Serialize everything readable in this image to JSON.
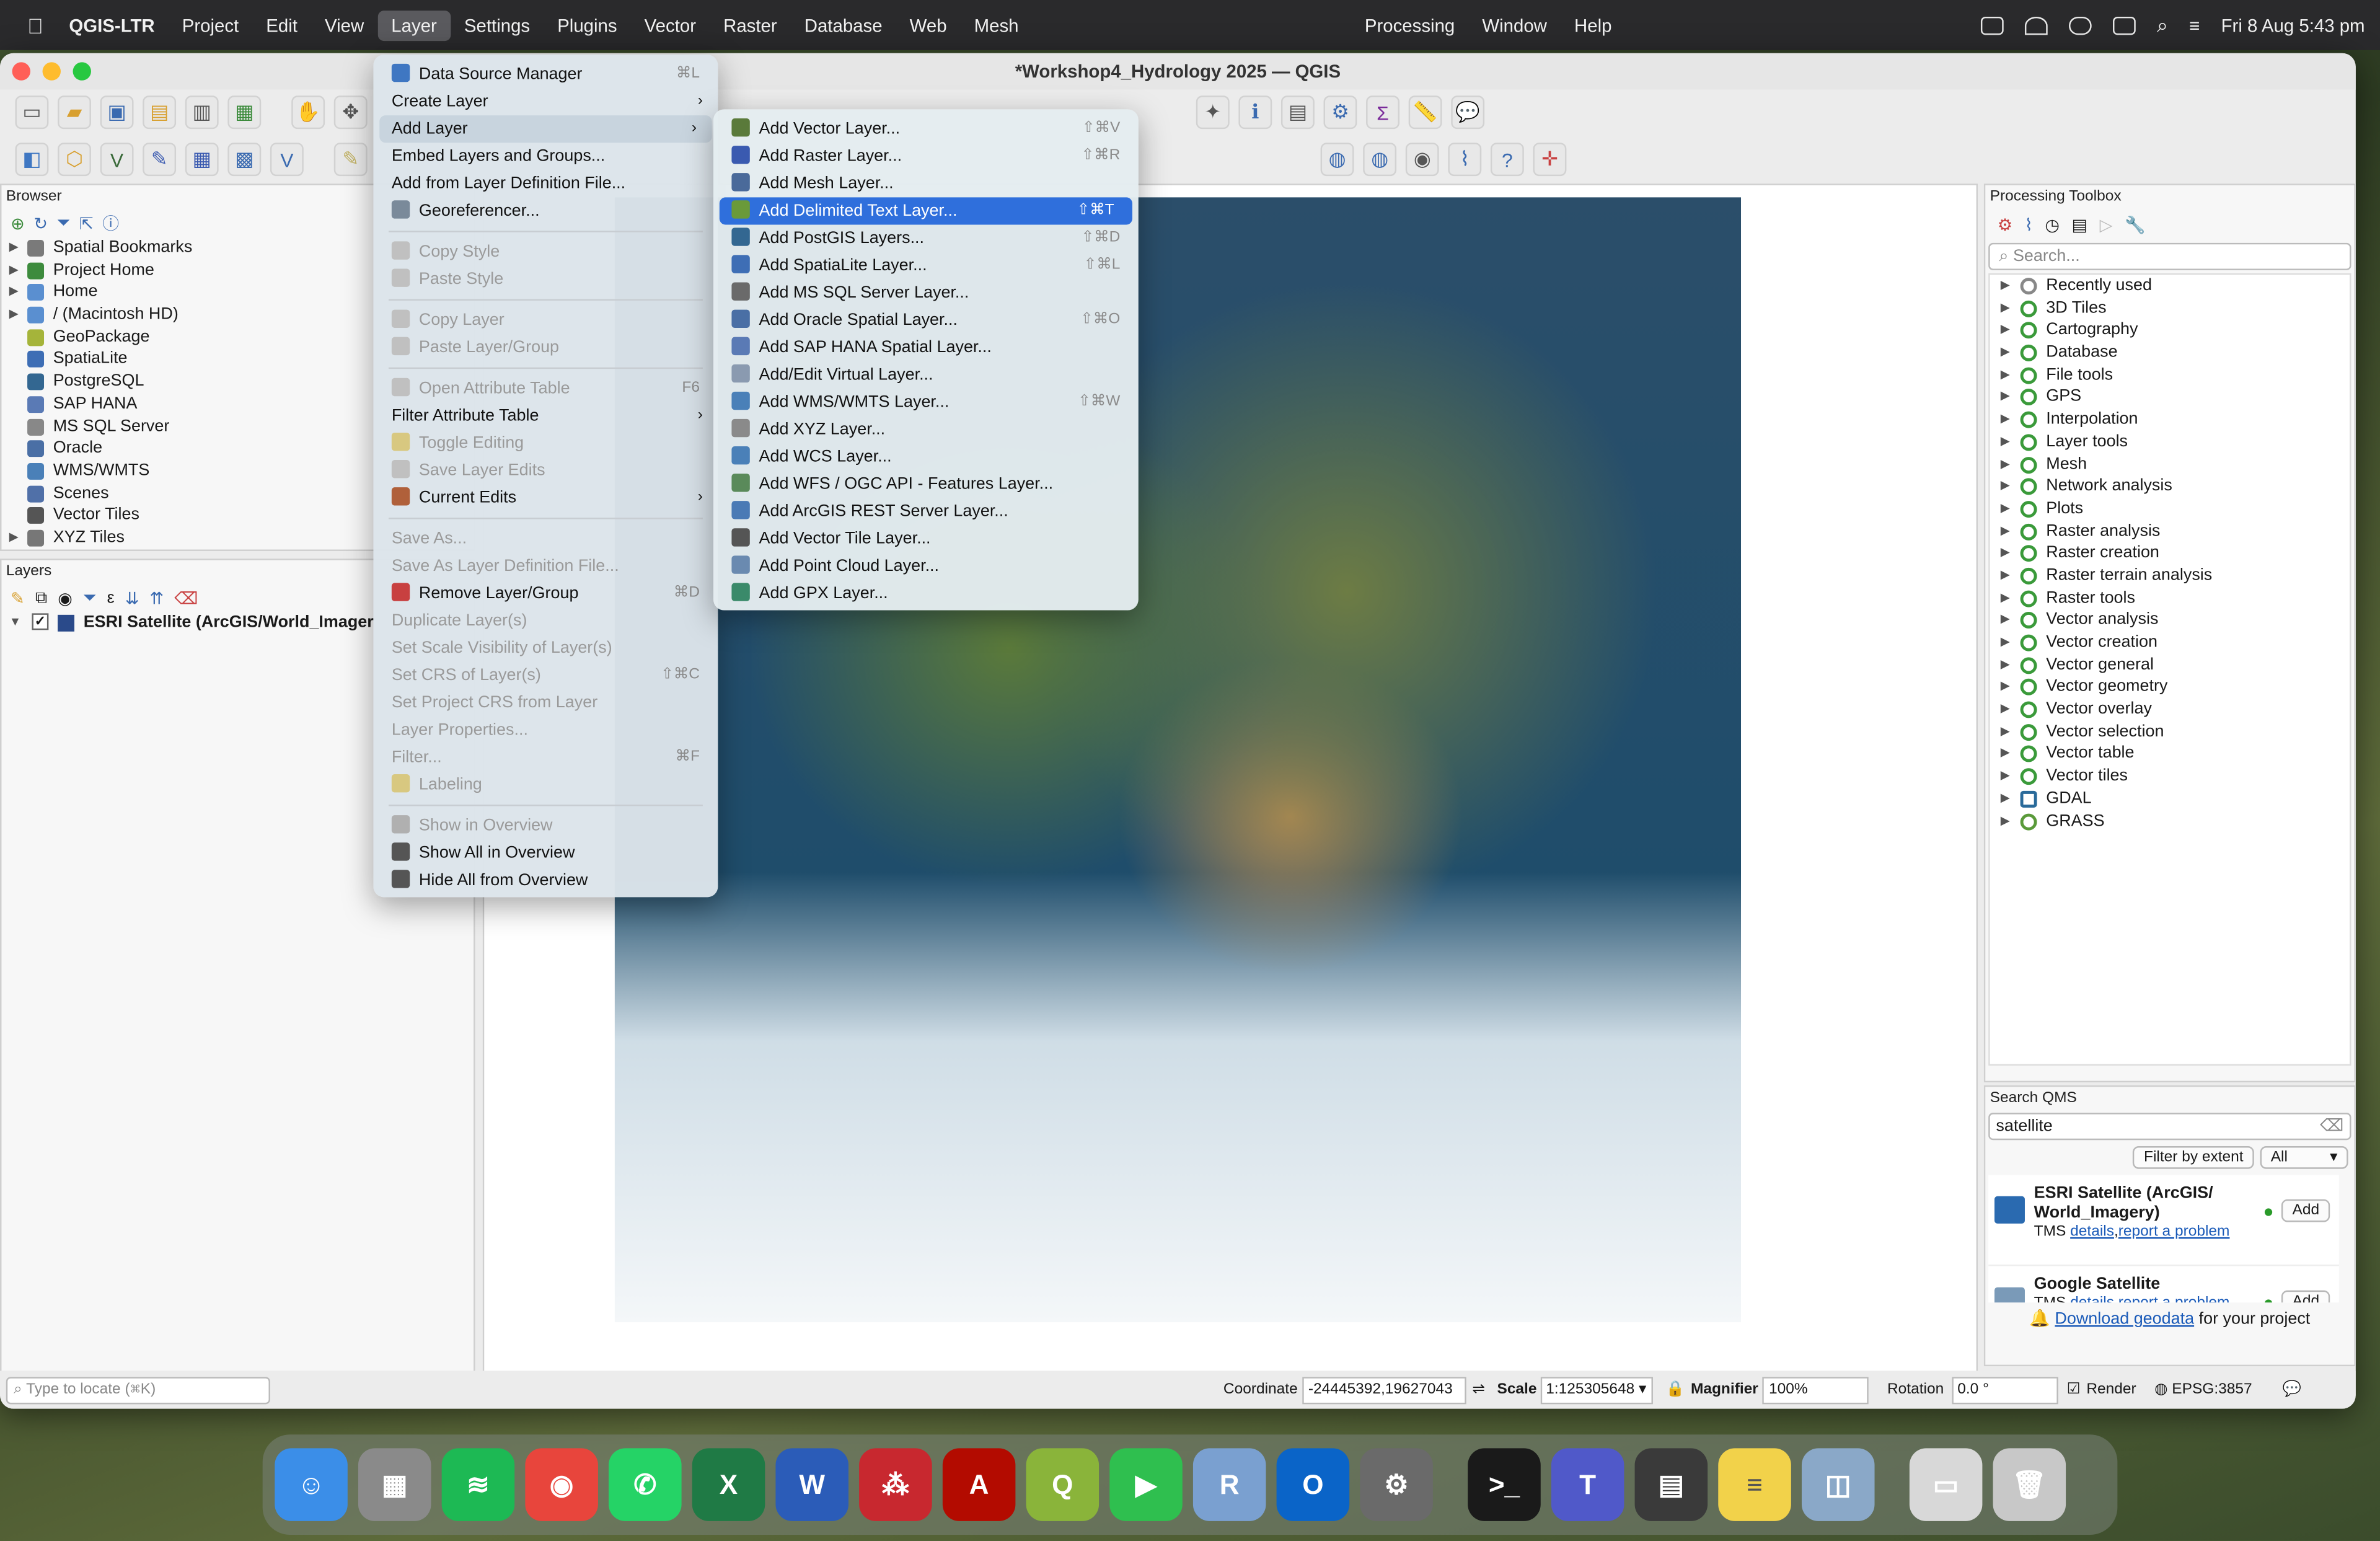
{
  "menubar": {
    "app": "QGIS-LTR",
    "items": [
      "Project",
      "Edit",
      "View",
      "Layer",
      "Settings",
      "Plugins",
      "Vector",
      "Raster",
      "Database",
      "Web",
      "Mesh"
    ],
    "right_items": [
      "Processing",
      "Window",
      "Help"
    ],
    "datetime": "Fri 8 Aug  5:43 pm"
  },
  "window": {
    "title": "*Workshop4_Hydrology 2025 — QGIS"
  },
  "browser": {
    "title": "Browser",
    "items": [
      {
        "label": "Spatial Bookmarks",
        "icon": "bookmark-icon",
        "color": "#7a7a7a",
        "expand": true
      },
      {
        "label": "Project Home",
        "icon": "project-home-icon",
        "color": "#3d8b3d",
        "expand": true
      },
      {
        "label": "Home",
        "icon": "home-folder-icon",
        "color": "#5a8fd0",
        "expand": true
      },
      {
        "label": "/ (Macintosh HD)",
        "icon": "disk-icon",
        "color": "#5a8fd0",
        "expand": true
      },
      {
        "label": "GeoPackage",
        "icon": "geopackage-icon",
        "color": "#a5b43a",
        "expand": false
      },
      {
        "label": "SpatiaLite",
        "icon": "spatialite-icon",
        "color": "#3e6eb5",
        "expand": false
      },
      {
        "label": "PostgreSQL",
        "icon": "postgresql-icon",
        "color": "#336791",
        "expand": false
      },
      {
        "label": "SAP HANA",
        "icon": "saphana-icon",
        "color": "#5a7ab5",
        "expand": false
      },
      {
        "label": "MS SQL Server",
        "icon": "mssql-icon",
        "color": "#888",
        "expand": false
      },
      {
        "label": "Oracle",
        "icon": "oracle-icon",
        "color": "#4a6fa5",
        "expand": false
      },
      {
        "label": "WMS/WMTS",
        "icon": "wms-icon",
        "color": "#4a80b8",
        "expand": false
      },
      {
        "label": "Scenes",
        "icon": "scenes-icon",
        "color": "#5070a8",
        "expand": false
      },
      {
        "label": "Vector Tiles",
        "icon": "vector-tiles-icon",
        "color": "#555",
        "expand": false
      },
      {
        "label": "XYZ Tiles",
        "icon": "xyz-tiles-icon",
        "color": "#777",
        "expand": true
      }
    ]
  },
  "layers": {
    "title": "Layers",
    "items": [
      {
        "label": "ESRI Satellite (ArcGIS/World_Imager",
        "checked": "✓"
      }
    ]
  },
  "layer_menu": {
    "items": [
      {
        "label": "Data Source Manager",
        "shortcut": "⌘L",
        "enabled": true,
        "icon": "data-source-manager-icon",
        "color": "#3f77c2"
      },
      {
        "label": "Create Layer",
        "submenu": true,
        "enabled": true
      },
      {
        "label": "Add Layer",
        "submenu": true,
        "enabled": true,
        "active": true
      },
      {
        "label": "Embed Layers and Groups...",
        "enabled": true
      },
      {
        "label": "Add from Layer Definition File...",
        "enabled": true
      },
      {
        "label": "Georeferencer...",
        "enabled": true,
        "icon": "georeferencer-icon",
        "color": "#7a8a9a"
      },
      {
        "sep": true
      },
      {
        "label": "Copy Style",
        "enabled": false,
        "icon": "copy-style-icon",
        "color": "#c0c0c0"
      },
      {
        "label": "Paste Style",
        "enabled": false,
        "icon": "paste-style-icon",
        "color": "#c0c0c0"
      },
      {
        "sep": true
      },
      {
        "label": "Copy Layer",
        "enabled": false,
        "icon": "copy-layer-icon",
        "color": "#c0c0c0"
      },
      {
        "label": "Paste Layer/Group",
        "enabled": false,
        "icon": "paste-layer-icon",
        "color": "#c0c0c0"
      },
      {
        "sep": true
      },
      {
        "label": "Open Attribute Table",
        "shortcut": "F6",
        "enabled": false,
        "icon": "attribute-table-icon",
        "color": "#c0c0c0"
      },
      {
        "label": "Filter Attribute Table",
        "submenu": true,
        "enabled": true
      },
      {
        "label": "Toggle Editing",
        "enabled": false,
        "icon": "toggle-editing-icon",
        "color": "#d8c880"
      },
      {
        "label": "Save Layer Edits",
        "enabled": false,
        "icon": "save-edits-icon",
        "color": "#c0c0c0"
      },
      {
        "label": "Current Edits",
        "submenu": true,
        "enabled": true,
        "icon": "current-edits-icon",
        "color": "#b0603a"
      },
      {
        "sep": true
      },
      {
        "label": "Save As...",
        "enabled": false
      },
      {
        "label": "Save As Layer Definition File...",
        "enabled": false
      },
      {
        "label": "Remove Layer/Group",
        "shortcut": "⌘D",
        "enabled": true,
        "icon": "remove-layer-icon",
        "color": "#c84040"
      },
      {
        "label": "Duplicate Layer(s)",
        "enabled": false
      },
      {
        "label": "Set Scale Visibility of Layer(s)",
        "enabled": false
      },
      {
        "label": "Set CRS of Layer(s)",
        "shortcut": "⇧⌘C",
        "enabled": false
      },
      {
        "label": "Set Project CRS from Layer",
        "enabled": false
      },
      {
        "label": "Layer Properties...",
        "enabled": false
      },
      {
        "label": "Filter...",
        "shortcut": "⌘F",
        "enabled": false
      },
      {
        "label": "Labeling",
        "enabled": false,
        "icon": "labeling-icon",
        "color": "#d8c880"
      },
      {
        "sep": true
      },
      {
        "label": "Show in Overview",
        "enabled": false,
        "icon": "overview-icon",
        "color": "#b0b0b0"
      },
      {
        "label": "Show All in Overview",
        "enabled": true,
        "icon": "overview-icon",
        "color": "#555"
      },
      {
        "label": "Hide All from Overview",
        "enabled": true,
        "icon": "overview-icon",
        "color": "#555"
      }
    ]
  },
  "add_layer_menu": {
    "items": [
      {
        "label": "Add Vector Layer...",
        "shortcut": "⇧⌘V",
        "icon": "vector-layer-icon",
        "color": "#5a7a3a"
      },
      {
        "label": "Add Raster Layer...",
        "shortcut": "⇧⌘R",
        "icon": "raster-layer-icon",
        "color": "#3a5ab0"
      },
      {
        "label": "Add Mesh Layer...",
        "icon": "mesh-layer-icon",
        "color": "#4a6a9a"
      },
      {
        "label": "Add Delimited Text Layer...",
        "shortcut": "⇧⌘T",
        "icon": "delimited-text-icon",
        "color": "#6a9a3a",
        "highlight": true
      },
      {
        "label": "Add PostGIS Layers...",
        "shortcut": "⇧⌘D",
        "icon": "postgis-icon",
        "color": "#336791"
      },
      {
        "label": "Add SpatiaLite Layer...",
        "shortcut": "⇧⌘L",
        "icon": "spatialite-icon",
        "color": "#3e6eb5"
      },
      {
        "label": "Add MS SQL Server Layer...",
        "icon": "mssql-icon",
        "color": "#6a6a6a"
      },
      {
        "label": "Add Oracle Spatial Layer...",
        "shortcut": "⇧⌘O",
        "icon": "oracle-icon",
        "color": "#4a6fa5"
      },
      {
        "label": "Add SAP HANA Spatial Layer...",
        "icon": "saphana-icon",
        "color": "#5a7ab5"
      },
      {
        "label": "Add/Edit Virtual Layer...",
        "icon": "virtual-layer-icon",
        "color": "#8a9ab0"
      },
      {
        "label": "Add WMS/WMTS Layer...",
        "shortcut": "⇧⌘W",
        "icon": "wms-icon",
        "color": "#4a80b8"
      },
      {
        "label": "Add XYZ Layer...",
        "icon": "xyz-icon",
        "color": "#8a8a8a"
      },
      {
        "label": "Add WCS Layer...",
        "icon": "wcs-icon",
        "color": "#4a80b8"
      },
      {
        "label": "Add WFS / OGC API - Features Layer...",
        "icon": "wfs-icon",
        "color": "#5a8a5a"
      },
      {
        "label": "Add ArcGIS REST Server Layer...",
        "icon": "arcgis-icon",
        "color": "#4a7ab5"
      },
      {
        "label": "Add Vector Tile Layer...",
        "icon": "vector-tile-icon",
        "color": "#555"
      },
      {
        "label": "Add Point Cloud Layer...",
        "icon": "point-cloud-icon",
        "color": "#6a8ab0"
      },
      {
        "label": "Add GPX Layer...",
        "icon": "gpx-icon",
        "color": "#3a8a6a"
      }
    ]
  },
  "processing": {
    "title": "Processing Toolbox",
    "search_placeholder": "Search...",
    "items": [
      "Recently used",
      "3D Tiles",
      "Cartography",
      "Database",
      "File tools",
      "GPS",
      "Interpolation",
      "Layer tools",
      "Mesh",
      "Network analysis",
      "Plots",
      "Raster analysis",
      "Raster creation",
      "Raster terrain analysis",
      "Raster tools",
      "Vector analysis",
      "Vector creation",
      "Vector general",
      "Vector geometry",
      "Vector overlay",
      "Vector selection",
      "Vector table",
      "Vector tiles",
      "GDAL",
      "GRASS"
    ]
  },
  "qms": {
    "title": "Search QMS",
    "query": "satellite",
    "filter_btn": "Filter by extent",
    "filter_select": "All",
    "results": [
      {
        "name": "ESRI Satellite (ArcGIS/ World_Imagery)",
        "type": "TMS",
        "details": "details",
        "report": "report a problem",
        "add": "Add"
      },
      {
        "name": "Google Satellite",
        "type": "TMS",
        "details": "details",
        "report": "report a problem",
        "add": "Add"
      }
    ],
    "download_link": "Download geodata",
    "download_suffix": "for your project"
  },
  "status": {
    "locate_placeholder": "Type to locate (⌘K)",
    "coordinate_label": "Coordinate",
    "coordinate": "-24445392,19627043",
    "scale_label": "Scale",
    "scale": "1:125305648",
    "magnifier_label": "Magnifier",
    "magnifier": "100%",
    "rotation_label": "Rotation",
    "rotation": "0.0 °",
    "render_label": "Render",
    "crs": "EPSG:3857"
  },
  "dock": [
    {
      "name": "finder",
      "color": "#3b8ee8",
      "glyph": "☺"
    },
    {
      "name": "launchpad",
      "color": "#8a8a8a",
      "glyph": "▦"
    },
    {
      "name": "spotify",
      "color": "#1db954",
      "glyph": "≋"
    },
    {
      "name": "chrome",
      "color": "#e8453c",
      "glyph": "◉"
    },
    {
      "name": "whatsapp",
      "color": "#25d366",
      "glyph": "✆"
    },
    {
      "name": "excel",
      "color": "#1f7a45",
      "glyph": "X"
    },
    {
      "name": "word",
      "color": "#2b5cb8",
      "glyph": "W"
    },
    {
      "name": "mendeley",
      "color": "#c8282f",
      "glyph": "⁂"
    },
    {
      "name": "acrobat",
      "color": "#b30b00",
      "glyph": "A"
    },
    {
      "name": "qgis",
      "color": "#8ab43a",
      "glyph": "Q"
    },
    {
      "name": "facetime",
      "color": "#2fbf4f",
      "glyph": "▶"
    },
    {
      "name": "rstudio",
      "color": "#7aa0d0",
      "glyph": "R"
    },
    {
      "name": "outlook",
      "color": "#0a64c8",
      "glyph": "O"
    },
    {
      "name": "system-settings",
      "color": "#6a6a6a",
      "glyph": "⚙"
    },
    {
      "name": "terminal",
      "color": "#1a1a1a",
      "glyph": ">_"
    },
    {
      "name": "teams",
      "color": "#5059c9",
      "glyph": "T"
    },
    {
      "name": "calculator",
      "color": "#3a3a3a",
      "glyph": "▤"
    },
    {
      "name": "notes",
      "color": "#f2d24a",
      "glyph": "≡"
    },
    {
      "name": "preview",
      "color": "#8aa8c8",
      "glyph": "◫"
    },
    {
      "name": "documents",
      "color": "#d8d8d8",
      "glyph": "▭"
    },
    {
      "name": "trash",
      "color": "#c8c8c8",
      "glyph": "🗑"
    }
  ]
}
